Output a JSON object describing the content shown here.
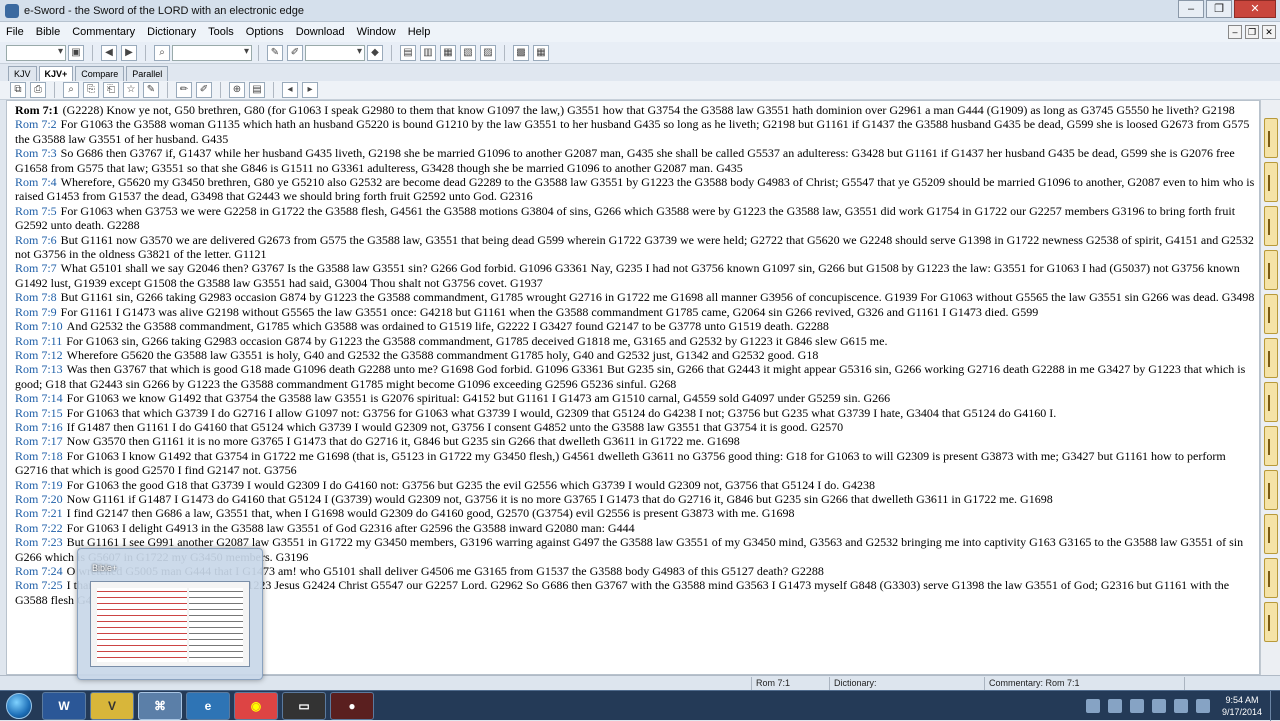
{
  "window": {
    "title": "e-Sword - the Sword of the LORD with an electronic edge"
  },
  "menu": [
    "File",
    "Bible",
    "Commentary",
    "Dictionary",
    "Tools",
    "Options",
    "Download",
    "Window",
    "Help"
  ],
  "tabs": [
    "KJV",
    "KJV+",
    "Compare",
    "Parallel"
  ],
  "verses": [
    {
      "ref": "Rom 7:1",
      "text": "(G2228) Know ye not, G50 brethren, G80 (for G1063 I speak G2980 to them that know G1097 the law,) G3551 how that G3754 the G3588 law G3551 hath dominion over G2961 a man G444 (G1909) as long as G3745 G5550 he liveth? G2198"
    },
    {
      "ref": "Rom 7:2",
      "text": "For G1063 the G3588 woman G1135 which hath an husband G5220 is bound G1210 by the law G3551 to her husband G435 so long as he liveth; G2198 but G1161 if G1437 the G3588 husband G435 be dead, G599 she is loosed G2673 from G575 the G3588 law G3551 of her husband. G435"
    },
    {
      "ref": "Rom 7:3",
      "text": "So G686 then G3767 if, G1437 while her husband G435 liveth, G2198 she be married G1096 to another G2087 man, G435 she shall be called G5537 an adulteress: G3428 but G1161 if G1437 her husband G435 be dead, G599 she is G2076 free G1658 from G575 that law; G3551 so that she G846 is G1511 no G3361 adulteress, G3428 though she be married G1096 to another G2087 man. G435"
    },
    {
      "ref": "Rom 7:4",
      "text": "Wherefore, G5620 my G3450 brethren, G80 ye G5210 also G2532 are become dead G2289 to the G3588 law G3551 by G1223 the G3588 body G4983 of Christ; G5547 that ye G5209 should be married G1096 to another, G2087 even to him who is raised G1453 from G1537 the dead, G3498 that G2443 we should bring forth fruit G2592 unto God. G2316"
    },
    {
      "ref": "Rom 7:5",
      "text": "For G1063 when G3753 we were G2258 in G1722 the G3588 flesh, G4561 the G3588 motions G3804 of sins, G266 which G3588 were by G1223 the G3588 law, G3551 did work G1754 in G1722 our G2257 members G3196 to bring forth fruit G2592 unto death. G2288"
    },
    {
      "ref": "Rom 7:6",
      "text": "But G1161 now G3570 we are delivered G2673 from G575 the G3588 law, G3551 that being dead G599 wherein G1722 G3739 we were held; G2722 that G5620 we G2248 should serve G1398 in G1722 newness G2538 of spirit, G4151 and G2532 not G3756 in the oldness G3821 of the letter. G1121"
    },
    {
      "ref": "Rom 7:7",
      "text": "What G5101 shall we say G2046 then? G3767 Is the G3588 law G3551 sin? G266 God forbid. G1096 G3361 Nay, G235 I had not G3756 known G1097 sin, G266 but G1508 by G1223 the law: G3551 for G1063 I had (G5037) not G3756 known G1492 lust, G1939 except G1508 the G3588 law G3551 had said, G3004 Thou shalt not G3756 covet. G1937"
    },
    {
      "ref": "Rom 7:8",
      "text": "But G1161 sin, G266 taking G2983 occasion G874 by G1223 the G3588 commandment, G1785 wrought G2716 in G1722 me G1698 all manner G3956 of concupiscence. G1939 For G1063 without G5565 the law G3551 sin G266 was dead. G3498"
    },
    {
      "ref": "Rom 7:9",
      "text": "For G1161 I G1473 was alive G2198 without G5565 the law G3551 once: G4218 but G1161 when the G3588 commandment G1785 came, G2064 sin G266 revived, G326 and G1161 I G1473 died. G599"
    },
    {
      "ref": "Rom 7:10",
      "text": "And G2532 the G3588 commandment, G1785 which G3588 was ordained to G1519 life, G2222 I G3427 found G2147 to be G3778 unto G1519 death. G2288"
    },
    {
      "ref": "Rom 7:11",
      "text": "For G1063 sin, G266 taking G2983 occasion G874 by G1223 the G3588 commandment, G1785 deceived G1818 me, G3165 and G2532 by G1223 it G846 slew G615 me."
    },
    {
      "ref": "Rom 7:12",
      "text": "Wherefore G5620 the G3588 law G3551 is holy, G40 and G2532 the G3588 commandment G1785 holy, G40 and G2532 just, G1342 and G2532 good. G18"
    },
    {
      "ref": "Rom 7:13",
      "text": "Was then G3767 that which is good G18 made G1096 death G2288 unto me? G1698 God forbid. G1096 G3361 But G235 sin, G266 that G2443 it might appear G5316 sin, G266 working G2716 death G2288 in me G3427 by G1223 that which is good; G18 that G2443 sin G266 by G1223 the G3588 commandment G1785 might become G1096 exceeding G2596 G5236 sinful. G268"
    },
    {
      "ref": "Rom 7:14",
      "text": "For G1063 we know G1492 that G3754 the G3588 law G3551 is G2076 spiritual: G4152 but G1161 I G1473 am G1510 carnal, G4559 sold G4097 under G5259 sin. G266"
    },
    {
      "ref": "Rom 7:15",
      "text": "For G1063 that which G3739 I do G2716 I allow G1097 not: G3756 for G1063 what G3739 I would, G2309 that G5124 do G4238 I not; G3756 but G235 what G3739 I hate, G3404 that G5124 do G4160 I."
    },
    {
      "ref": "Rom 7:16",
      "text": "If G1487 then G1161 I do G4160 that G5124 which G3739 I would G2309 not, G3756 I consent G4852 unto the G3588 law G3551 that G3754 it is good. G2570"
    },
    {
      "ref": "Rom 7:17",
      "text": "Now G3570 then G1161 it is no more G3765 I G1473 that do G2716 it, G846 but G235 sin G266 that dwelleth G3611 in G1722 me. G1698"
    },
    {
      "ref": "Rom 7:18",
      "text": "For G1063 I know G1492 that G3754 in G1722 me G1698 (that is, G5123 in G1722 my G3450 flesh,) G4561 dwelleth G3611 no G3756 good thing: G18 for G1063 to will G2309 is present G3873 with me; G3427 but G1161 how to perform G2716 that which is good G2570 I find G2147 not. G3756"
    },
    {
      "ref": "Rom 7:19",
      "text": "For G1063 the good G18 that G3739 I would G2309 I do G4160 not: G3756 but G235 the evil G2556 which G3739 I would G2309 not, G3756 that G5124 I do. G4238"
    },
    {
      "ref": "Rom 7:20",
      "text": "Now G1161 if G1487 I G1473 do G4160 that G5124 I (G3739) would G2309 not, G3756 it is no more G3765 I G1473 that do G2716 it, G846 but G235 sin G266 that dwelleth G3611 in G1722 me. G1698"
    },
    {
      "ref": "Rom 7:21",
      "text": "I find G2147 then G686 a law, G3551 that, when I G1698 would G2309 do G4160 good, G2570 (G3754) evil G2556 is present G3873 with me. G1698"
    },
    {
      "ref": "Rom 7:22",
      "text": "For G1063 I delight G4913 in the G3588 law G3551 of God G2316 after G2596 the G3588 inward G2080 man: G444"
    },
    {
      "ref": "Rom 7:23",
      "text": "But G1161 I see G991 another G2087 law G3551 in G1722 my G3450 members, G3196 warring against G497 the G3588 law G3551 of my G3450 mind, G3563 and G2532 bringing me into captivity G163 G3165 to the G3588 law G3551 of sin G266 which is G5607 in G1722 my G3450 members. G3196"
    },
    {
      "ref": "Rom 7:24",
      "text": "O wretched G5005 man G444 that I G1473 am! who G5101 shall deliver G4506 me G3165 from G1537 the G3588 body G4983 of this G5127 death? G2288"
    },
    {
      "ref": "Rom 7:25",
      "text": "I thank G2168 God G2316 through G1223 Jesus G2424 Christ G5547 our G2257 Lord. G2962 So G686 then G3767 with the G3588 mind G3563 I G1473 myself G848 (G3303) serve G1398 the law G3551 of God; G2316 but G1161 with the G3588 flesh G4561 the law G3551 of sin. G266"
    }
  ],
  "status": {
    "verse": "Rom 7:1",
    "dictionary": "Dictionary:",
    "commentary": "Commentary: Rom 7:1"
  },
  "thumbnail": {
    "title": "Bible+"
  },
  "clock": {
    "time": "9:54 AM",
    "date": "9/17/2014"
  }
}
